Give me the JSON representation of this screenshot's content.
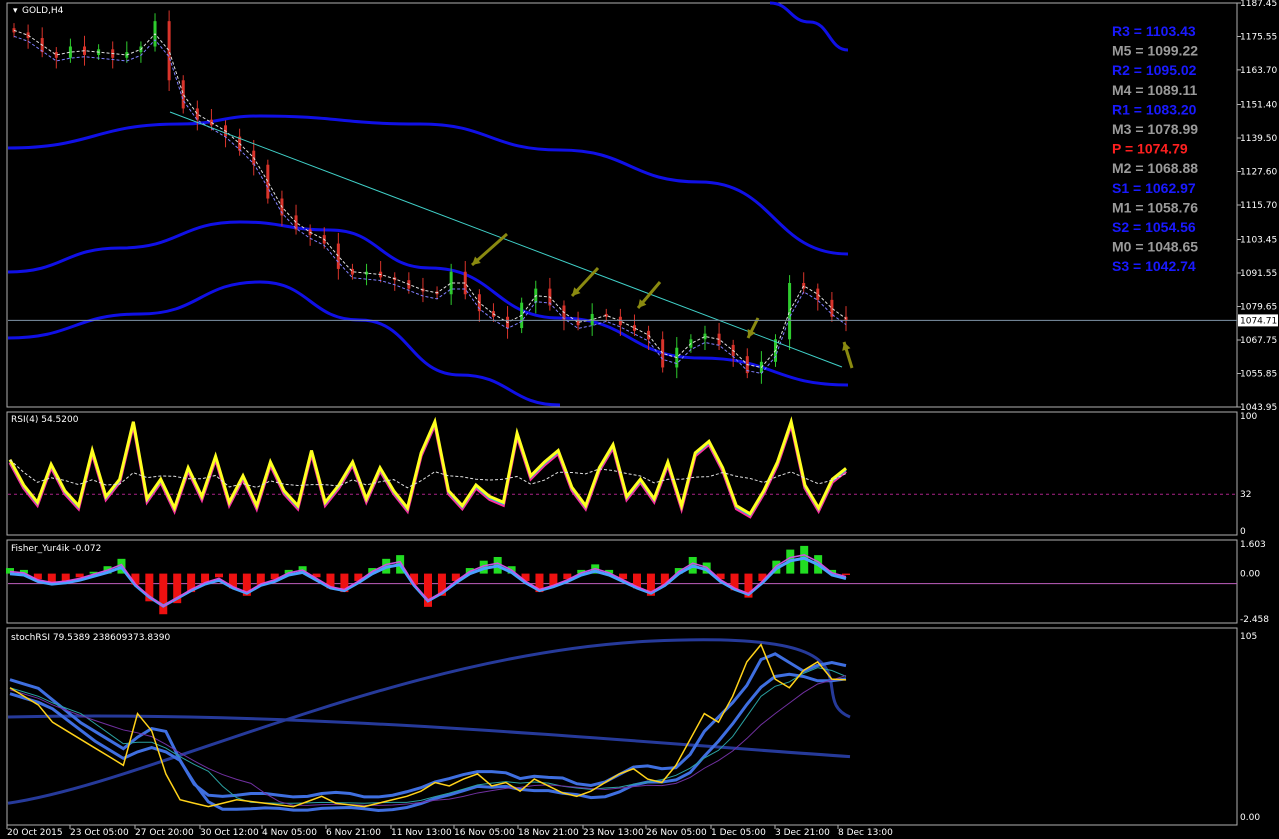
{
  "colors": {
    "background": "#000000",
    "border": "#b0b0b0",
    "bull": "#2ecc2e",
    "bear": "#d9342b",
    "band": "#1010e6",
    "trendline": "#40d0c8",
    "arrow": "#8a8a10",
    "pivot_r": "#1a1aff",
    "pivot_m": "#9a9a9a",
    "pivot_p": "#ff2020",
    "rsi_main": "#ffff20",
    "rsi_pink": "#ff2fa0",
    "fisher_pos": "#22dd22",
    "fisher_neg": "#ee1111",
    "stoch_blue": "#3f6fe0",
    "stoch_yellow": "#ffd21a"
  },
  "panels": {
    "main": {
      "title": "GOLD,H4",
      "menu_icon": "triangle-down-icon",
      "price_label": "1074.71"
    },
    "rsi": {
      "title": "RSI(4) 54.5200"
    },
    "fisher": {
      "title": "Fisher_Yur4ik -0.072"
    },
    "stoch": {
      "title": "stochRSI 79.5389 238609373.8390"
    }
  },
  "pivots": [
    {
      "label": "R3 = 1103.43",
      "kind": "r"
    },
    {
      "label": "M5 = 1099.22",
      "kind": "m"
    },
    {
      "label": "R2 = 1095.02",
      "kind": "r"
    },
    {
      "label": "M4 = 1089.11",
      "kind": "m"
    },
    {
      "label": "R1 = 1083.20",
      "kind": "r"
    },
    {
      "label": "M3 = 1078.99",
      "kind": "m"
    },
    {
      "label": "P   = 1074.79",
      "kind": "p"
    },
    {
      "label": "M2 = 1068.88",
      "kind": "m"
    },
    {
      "label": "S1 = 1062.97",
      "kind": "r"
    },
    {
      "label": "M1 = 1058.76",
      "kind": "m"
    },
    {
      "label": "S2 = 1054.56",
      "kind": "r"
    },
    {
      "label": "M0 = 1048.65",
      "kind": "m"
    },
    {
      "label": "S3 = 1042.74",
      "kind": "r"
    }
  ],
  "chart_data": [
    {
      "type": "candlestick",
      "title": "GOLD,H4",
      "ylim": [
        1043.95,
        1187.45
      ],
      "y_ticks": [
        "1187.45",
        "1175.55",
        "1163.70",
        "1151.40",
        "1139.50",
        "1127.60",
        "1115.70",
        "1103.45",
        "1091.55",
        "1079.65",
        "1067.75",
        "1055.85",
        "1043.95"
      ],
      "x_ticks": [
        "20 Oct 2015",
        "23 Oct 05:00",
        "27 Oct 20:00",
        "30 Oct 12:00",
        "4 Nov 05:00",
        "6 Nov 21:00",
        "11 Nov 13:00",
        "16 Nov 05:00",
        "18 Nov 21:00",
        "23 Nov 13:00",
        "26 Nov 05:00",
        "1 Dec 05:00",
        "3 Dec 21:00",
        "8 Dec 13:00"
      ],
      "close_path": [
        1177,
        1175,
        1170,
        1168,
        1172,
        1169,
        1171,
        1168,
        1170,
        1172,
        1181,
        1160,
        1150,
        1146,
        1144,
        1140,
        1135,
        1130,
        1118,
        1112,
        1107,
        1105,
        1102,
        1093,
        1091,
        1092,
        1090,
        1089,
        1086,
        1085,
        1084,
        1092,
        1084,
        1078,
        1076,
        1072,
        1081,
        1086,
        1080,
        1075,
        1073,
        1077,
        1076,
        1073,
        1071,
        1068,
        1058,
        1065,
        1068,
        1070,
        1066,
        1062,
        1056,
        1060,
        1068,
        1088,
        1086,
        1082,
        1076,
        1074.71
      ],
      "current_price": 1074.71,
      "annotations": [
        "arrow",
        "arrow",
        "arrow",
        "arrow",
        "arrow",
        "arrow"
      ]
    },
    {
      "type": "line",
      "title": "RSI(4) 54.5200",
      "ylim": [
        0,
        100
      ],
      "y_ticks": [
        "100",
        "32",
        "0"
      ],
      "level": 32,
      "series": [
        {
          "values": [
            62,
            40,
            25,
            58,
            35,
            22,
            70,
            30,
            45,
            95,
            28,
            45,
            20,
            55,
            30,
            65,
            25,
            48,
            22,
            60,
            35,
            22,
            70,
            25,
            40,
            60,
            28,
            55,
            35,
            20,
            68,
            95,
            35,
            22,
            40,
            30,
            25,
            85,
            48,
            60,
            70,
            38,
            22,
            55,
            75,
            30,
            45,
            28,
            60,
            22,
            68,
            78,
            55,
            22,
            15,
            35,
            60,
            95,
            40,
            20,
            45,
            54.52
          ]
        }
      ]
    },
    {
      "type": "bar",
      "title": "Fisher_Yur4ik -0.072",
      "ylim": [
        -2.458,
        1.603
      ],
      "y_ticks": [
        "1.603",
        "0.00",
        "-2.458"
      ],
      "series": [
        {
          "name": "fisher",
          "values": [
            0.3,
            0.2,
            -0.3,
            -0.5,
            -0.4,
            -0.2,
            0.1,
            0.4,
            0.8,
            -0.6,
            -1.5,
            -2.2,
            -1.6,
            -1.0,
            -0.5,
            -0.2,
            -0.8,
            -1.2,
            -0.6,
            -0.3,
            0.2,
            0.4,
            -0.2,
            -0.8,
            -1.0,
            -0.4,
            0.3,
            0.8,
            1.0,
            -0.6,
            -1.8,
            -1.2,
            -0.4,
            0.3,
            0.7,
            0.9,
            0.4,
            -0.4,
            -1.0,
            -0.7,
            -0.3,
            0.2,
            0.5,
            0.2,
            -0.3,
            -0.8,
            -1.2,
            -0.6,
            0.3,
            0.9,
            0.6,
            -0.3,
            -0.9,
            -1.3,
            -0.4,
            0.7,
            1.3,
            1.5,
            1.0,
            0.2,
            -0.072
          ]
        }
      ]
    },
    {
      "type": "line",
      "title": "stochRSI 79.5389 238609373.8390",
      "ylim": [
        0,
        105
      ],
      "y_ticks": [
        "105",
        "0.00"
      ],
      "series": [
        {
          "name": "stoch",
          "values": [
            75,
            70,
            65,
            55,
            50,
            45,
            40,
            35,
            30,
            60,
            50,
            25,
            10,
            8,
            6,
            8,
            10,
            9,
            8,
            7,
            6,
            9,
            12,
            8,
            7,
            6,
            8,
            10,
            12,
            15,
            20,
            18,
            22,
            25,
            18,
            20,
            15,
            22,
            18,
            14,
            12,
            15,
            20,
            25,
            28,
            22,
            20,
            30,
            45,
            60,
            55,
            70,
            90,
            100,
            80,
            75,
            85,
            90,
            80,
            79.54
          ]
        }
      ]
    }
  ]
}
